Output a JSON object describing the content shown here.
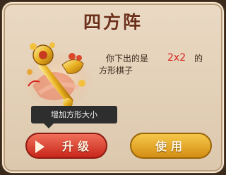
{
  "dialog": {
    "title": "四方阵",
    "description_prefix": "你下出的是",
    "description_highlight": "2x2",
    "description_suffix": "的",
    "description_line2": "方形棋子",
    "tooltip": "增加方形大小"
  },
  "buttons": {
    "upgrade_label": "升级",
    "use_label": "使用"
  },
  "item": {
    "icon": "golden-scepter-icon",
    "highlight_color": "#d8261e"
  }
}
